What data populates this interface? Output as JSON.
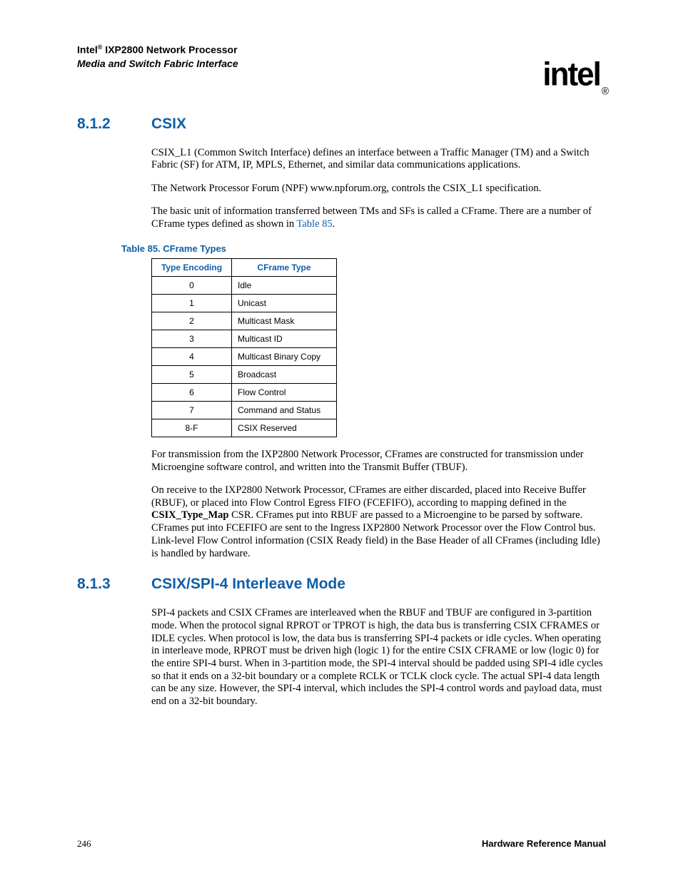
{
  "header": {
    "brand": "Intel",
    "reg": "®",
    "product": " IXP2800 Network Processor",
    "subtitle": "Media and Switch Fabric Interface",
    "logo_text": "intel",
    "logo_reg": "®"
  },
  "section1": {
    "number": "8.1.2",
    "title": "CSIX",
    "p1": "CSIX_L1 (Common Switch Interface) defines an interface between a Traffic Manager (TM) and a Switch Fabric (SF) for ATM, IP, MPLS, Ethernet, and similar data communications applications.",
    "p2": "The Network Processor Forum (NPF) www.npforum.org, controls the CSIX_L1 specification.",
    "p3_a": "The basic unit of information transferred between TMs and SFs is called a CFrame. There are a number of CFrame types defined as shown in ",
    "p3_ref": "Table 85",
    "p3_b": ".",
    "table_caption": "Table 85.  CFrame Types",
    "table_headers": {
      "h1": "Type Encoding",
      "h2": "CFrame Type"
    },
    "table_rows": [
      {
        "enc": "0",
        "type": "Idle"
      },
      {
        "enc": "1",
        "type": "Unicast"
      },
      {
        "enc": "2",
        "type": "Multicast Mask"
      },
      {
        "enc": "3",
        "type": "Multicast ID"
      },
      {
        "enc": "4",
        "type": "Multicast Binary Copy"
      },
      {
        "enc": "5",
        "type": "Broadcast"
      },
      {
        "enc": "6",
        "type": "Flow Control"
      },
      {
        "enc": "7",
        "type": "Command and Status"
      },
      {
        "enc": "8-F",
        "type": "CSIX Reserved"
      }
    ],
    "p4": "For transmission from the IXP2800 Network Processor, CFrames are constructed for transmission under Microengine software control, and written into the Transmit Buffer (TBUF).",
    "p5_a": "On receive to the IXP2800 Network Processor, CFrames are either discarded, placed into Receive Buffer (RBUF), or placed into Flow Control Egress FIFO (FCEFIFO), according to mapping defined in the ",
    "p5_b": "CSIX_Type_Map",
    "p5_c": " CSR. CFrames put into RBUF are passed to a Microengine to be parsed by software. CFrames put into FCEFIFO are sent to the Ingress IXP2800 Network Processor over the Flow Control bus. Link-level Flow Control information (CSIX Ready field) in the Base Header of all CFrames (including Idle) is handled by hardware."
  },
  "section2": {
    "number": "8.1.3",
    "title": "CSIX/SPI-4 Interleave Mode",
    "p1": "SPI-4 packets and CSIX CFrames are interleaved when the RBUF and TBUF are configured in 3-partition mode. When the protocol signal RPROT or TPROT is high, the data bus is transferring CSIX CFRAMES or IDLE cycles. When protocol is low, the data bus is transferring SPI-4 packets or idle cycles. When operating in interleave mode, RPROT must be driven high (logic 1) for the entire CSIX CFRAME or low (logic 0) for the entire SPI-4 burst. When in 3-partition mode, the SPI-4 interval should be padded using SPI-4 idle cycles so that it ends on a 32-bit boundary or a complete RCLK or TCLK clock cycle. The actual SPI-4 data length can be any size. However, the SPI-4 interval, which includes the SPI-4 control words and payload data, must end on a 32-bit boundary."
  },
  "footer": {
    "page_number": "246",
    "doc_title": "Hardware Reference Manual"
  }
}
